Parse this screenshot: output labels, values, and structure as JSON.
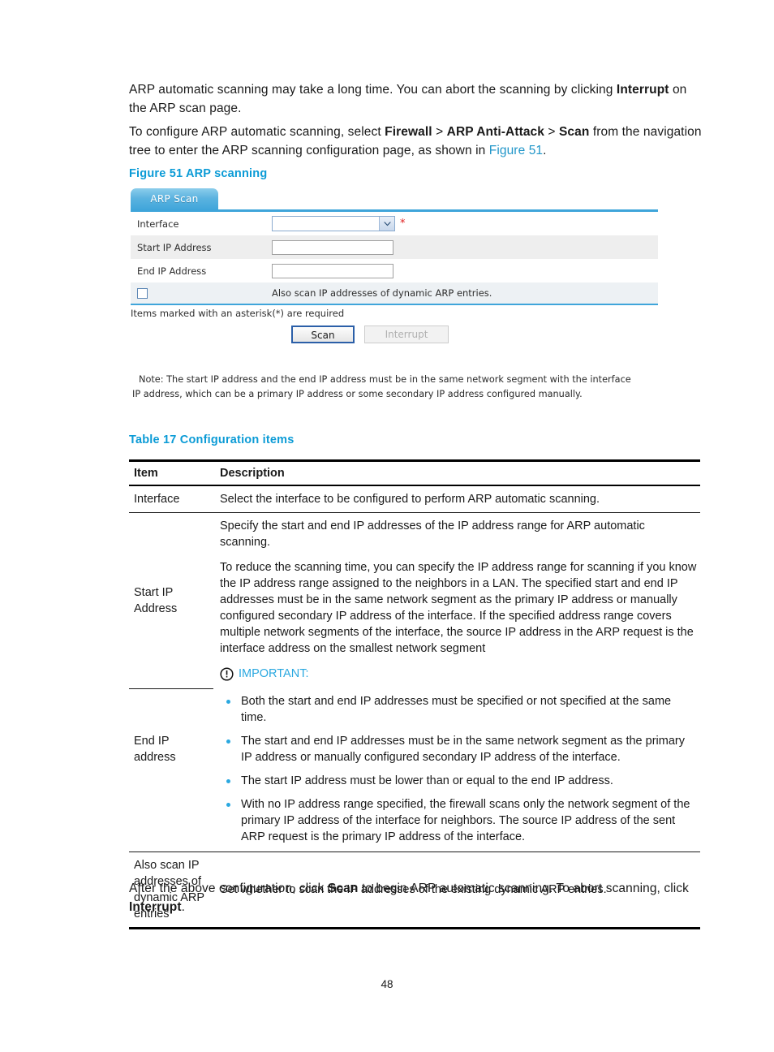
{
  "colors": {
    "heading_blue": "#0b9bd6",
    "link_blue": "#2196c9",
    "accent_cyan": "#2aa8e0",
    "tab_blue": "#3fa5da",
    "required_red": "#e02020"
  },
  "prose": {
    "intro_part1": "ARP automatic scanning may take a long time. You can abort the scanning by clicking ",
    "intro_bold": "Interrupt",
    "intro_part2": " on the ARP scan page.",
    "config_part1": "To configure ARP automatic scanning, select ",
    "config_bold1": "Firewall",
    "config_sep1": " > ",
    "config_bold2": "ARP Anti-Attack",
    "config_sep2": " > ",
    "config_bold3": "Scan",
    "config_part2": " from the navigation tree to enter the ARP scanning configuration page, as shown in ",
    "config_link": "Figure 51",
    "config_end": ".",
    "after_part1": "After the above configuration, click ",
    "after_bold1": "Scan",
    "after_part2": " to begin ARP automatic scanning. To abort scanning, click ",
    "after_bold2": "Interrupt",
    "after_end": "."
  },
  "figure": {
    "caption": "Figure 51 ARP scanning",
    "tab_label": "ARP Scan",
    "rows": [
      {
        "label": "Interface",
        "control": "dropdown",
        "value": "",
        "required": true
      },
      {
        "label": "Start IP Address",
        "control": "textbox",
        "value": "",
        "required": false
      },
      {
        "label": "End IP Address",
        "control": "textbox",
        "value": "",
        "required": false
      }
    ],
    "checkbox_caption": "Also scan IP addresses of dynamic ARP entries.",
    "checkbox_checked": false,
    "asterisk_note": "Items marked with an asterisk(*) are required",
    "scan_button": "Scan",
    "interrupt_button": "Interrupt",
    "interrupt_disabled": true,
    "note_line1": "Note: The start IP address and the end IP address must be in the same network segment with the interface",
    "note_line2": "IP address, which can be a primary IP address or some secondary IP address configured manually."
  },
  "table": {
    "caption": "Table 17 Configuration items",
    "headers": {
      "item": "Item",
      "description": "Description"
    },
    "rows": [
      {
        "item": "Interface",
        "paragraphs": [
          "Select the interface to be configured to perform ARP automatic scanning."
        ]
      },
      {
        "item": "Start IP\nAddress",
        "item_line1": "Start IP",
        "item_line2": "Address",
        "paragraphs": [
          "Specify the start and end IP addresses of the IP address range for ARP automatic scanning.",
          "To reduce the scanning time, you can specify the IP address range for scanning if you know the IP address range assigned to the neighbors in a LAN. The specified start and end IP addresses must be in the same network segment as the primary IP address or manually configured secondary IP address of the interface. If the specified address range covers multiple network segments of the interface, the source IP address in the ARP request is the interface address on the smallest network segment"
        ],
        "important_label": "IMPORTANT:"
      },
      {
        "item_line1": "End IP",
        "item_line2": "address",
        "bullets": [
          "Both the start and end IP addresses must be specified or not specified at the same time.",
          "The start and end IP addresses must be in the same network segment as the primary IP address or manually configured secondary IP address of the interface.",
          "The start IP address must be lower than or equal to the end IP address.",
          "With no IP address range specified, the firewall scans only the network segment of the primary IP address of the interface for neighbors. The source IP address of the sent ARP request is the primary IP address of the interface."
        ]
      },
      {
        "item_line1": "Also scan IP",
        "item_line2": "addresses of",
        "item_line3": "dynamic ARP",
        "item_line4": "entries",
        "paragraphs": [
          "Set whether to scan the IP addresses of the existing dynamic ARP entries."
        ]
      }
    ]
  },
  "footer": {
    "page_number": "48"
  }
}
